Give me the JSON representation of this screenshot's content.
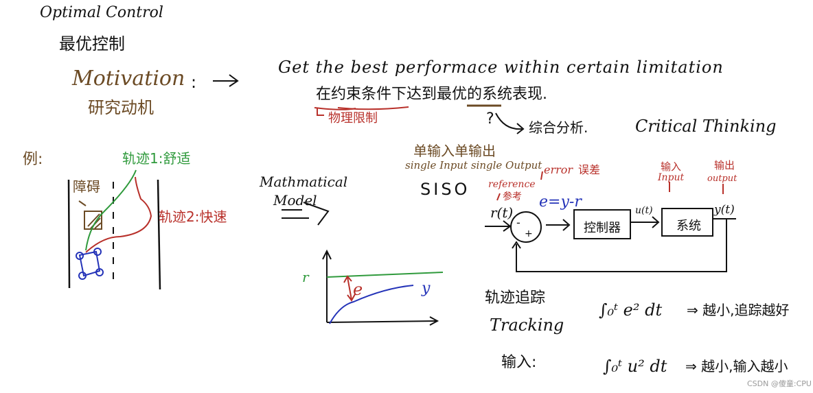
{
  "title": {
    "en": "Optimal Control",
    "zh": "最优控制"
  },
  "motivation": {
    "label": "Motivation",
    "label_zh": "研究动机",
    "colon": ":",
    "statement_en": "Get the best performace within certain limitation",
    "statement_zh": "在约束条件下达到最优的系统表现.",
    "constraint_note": "物理限制",
    "question_mark": "?",
    "analysis_zh": "综合分析.",
    "analysis_en": "Critical Thinking"
  },
  "example": {
    "label": "例:",
    "obstacle": "障碍",
    "trajectory1": "轨迹1:舒适",
    "trajectory2": "轨迹2:快速",
    "colors": {
      "trajectory1": "#2f9a3c",
      "trajectory2": "#b8302a",
      "car": "#2433b8",
      "obstacle": "#6b4a24"
    }
  },
  "model": {
    "label_line1": "Mathmatical",
    "label_line2": "Model",
    "graph": {
      "r_label": "r",
      "e_label": "e",
      "y_label": "y"
    }
  },
  "siso": {
    "zh": "单输入单输出",
    "en": "single Input single Output",
    "abbr": "SISO"
  },
  "block_diagram": {
    "reference_en": "reference",
    "reference_zh": "参考",
    "r_signal": "r(t)",
    "error_en": "error",
    "error_zh": "误差",
    "error_eq": "e=y-r",
    "minus": "-",
    "plus": "+",
    "input_zh": "输入",
    "input_en": "Input",
    "u_signal": "u(t)",
    "controller": "控制器",
    "system": "系统",
    "output_zh": "输出",
    "output_en": "output",
    "y_signal": "y(t)"
  },
  "cost": {
    "tracking_zh": "轨迹追踪",
    "tracking_en": "Tracking",
    "tracking_integral": "∫₀ᵗ e² dt",
    "tracking_result": "⇒ 越小,追踪越好",
    "input_label": "输入:",
    "input_integral": "∫₀ᵗ u² dt",
    "input_result": "⇒ 越小,输入越小"
  },
  "watermark": "CSDN @傻童:CPU"
}
